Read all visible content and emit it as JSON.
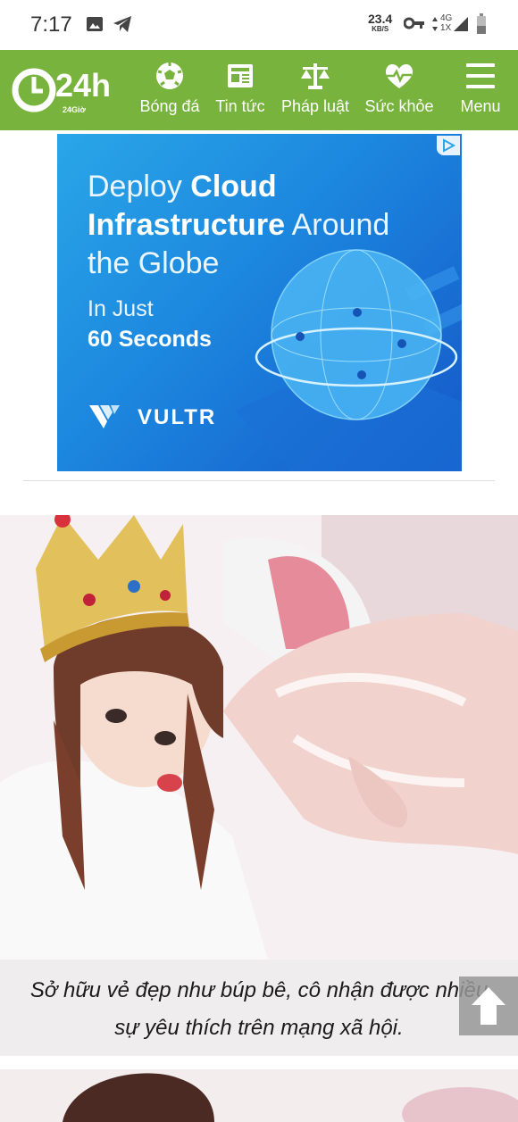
{
  "status_bar": {
    "time": "7:17",
    "net_speed_value": "23.4",
    "net_speed_unit": "KB/S",
    "network_type": "4G",
    "sim_slot": "1X",
    "icons": [
      "image-icon",
      "telegram-icon",
      "vpn-key-icon",
      "data-arrows-icon",
      "signal-icon",
      "battery-icon"
    ]
  },
  "nav": {
    "brand": "24h",
    "brand_sub": "24Giờ",
    "items": [
      {
        "label": "Bóng đá",
        "icon": "soccer-ball-icon"
      },
      {
        "label": "Tin tức",
        "icon": "newspaper-icon"
      },
      {
        "label": "Pháp luật",
        "icon": "scales-icon"
      },
      {
        "label": "Sức khỏe",
        "icon": "heart-pulse-icon"
      },
      {
        "label": "Menu",
        "icon": "hamburger-icon"
      }
    ],
    "colors": {
      "bar": "#78b43d",
      "text": "#ffffff"
    }
  },
  "ad": {
    "headline_part1": "Deploy ",
    "headline_bold1": "Cloud",
    "headline_bold2": "Infrastructure",
    "headline_part2": " Around",
    "headline_part3": "the Globe",
    "sub_line1": "In Just",
    "sub_line2": "60 Seconds",
    "brand": "VULTR",
    "adchoices_icon": "adchoices-icon",
    "colors": {
      "bg_start": "#2aa6e8",
      "bg_end": "#1557c9"
    }
  },
  "article": {
    "caption": "Sở hữu vẻ đẹp như búp bê, cô nhận được nhiều sự yêu thích trên mạng xã hội."
  },
  "scroll_top": {
    "icon": "arrow-up-icon"
  }
}
